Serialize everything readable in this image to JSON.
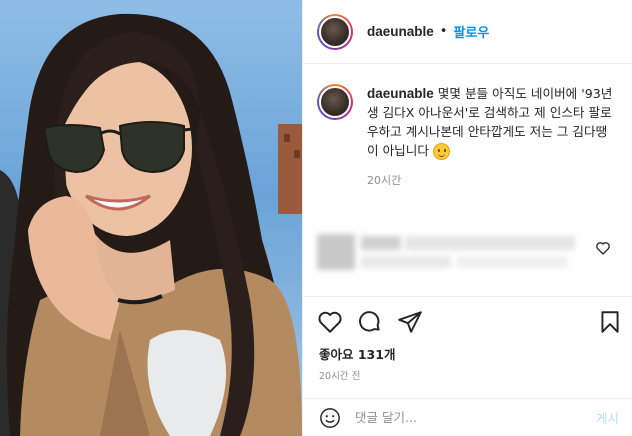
{
  "post": {
    "image_description_icon": "photo-woman-sunglasses",
    "author": {
      "username": "daeunable",
      "follow_label": "팔로우",
      "separator": "•"
    },
    "caption": {
      "username": "daeunable",
      "text": "몇몇 분들 아직도 네이버에 '93년생 김다X 아나운서'로 검색하고 제 인스타 팔로우하고 계시나본데 안타깝게도 저는 그 김다땡이 아닙니다",
      "emoji": "smiling-face",
      "time": "20시간"
    },
    "likes_label": "좋아요 131개",
    "posted_time": "20시간 전",
    "comment": {
      "placeholder": "댓글 달기...",
      "post_label": "게시"
    }
  },
  "colors": {
    "accent": "#0095f6",
    "post_disabled": "#b2dffc",
    "muted": "#8e8e8e",
    "border": "#efefef"
  }
}
